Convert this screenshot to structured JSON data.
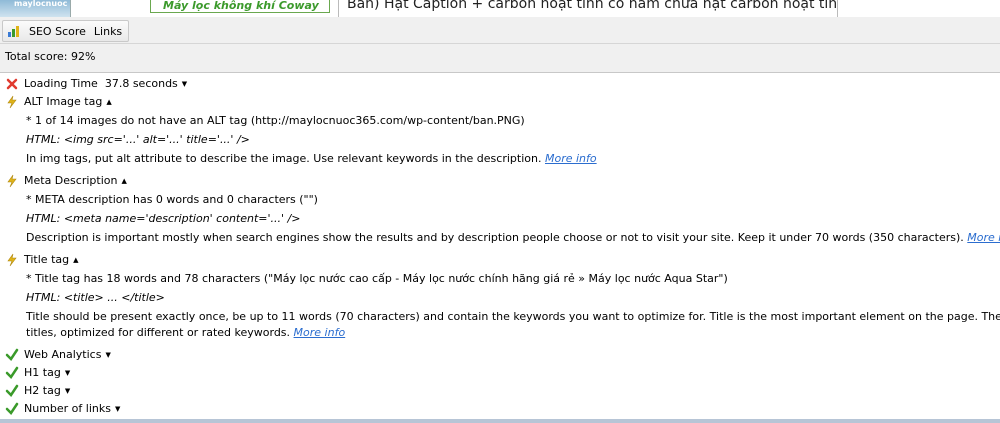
{
  "webpage": {
    "green_banner": "Máy lọc không khí Coway",
    "description_fragment": "Bản) Hạt Caption + carbon hoạt tính có hàm chứa hạt carbon hoạt tính, sẽ khử"
  },
  "toolbar": {
    "tab_seo_score": "SEO Score",
    "tab_links": "Links"
  },
  "summary": {
    "total_score": "Total score: 92%"
  },
  "items": [
    {
      "status": "error",
      "title": "Loading Time",
      "value": "37.8 seconds",
      "expanded": false,
      "details": []
    },
    {
      "status": "warning",
      "title": "ALT Image tag",
      "expanded": true,
      "details": [
        "* 1 of 14 images do not have an ALT tag (http://maylocnuoc365.com/wp-content/ban.PNG)",
        "HTML: <img src='...' alt='...' title='...' />",
        "In img tags, put alt attribute to describe the image. Use relevant keywords in the description."
      ],
      "more_info": "More info"
    },
    {
      "status": "warning",
      "title": "Meta Description",
      "expanded": true,
      "details": [
        "* META description has 0 words and 0 characters (\"\")",
        "HTML: <meta name='description' content='...' />",
        "Description is important mostly when search engines show the results and by description people choose or not to visit your site. Keep it under 70 words (350 characters)."
      ],
      "more_info": "More info"
    },
    {
      "status": "warning",
      "title": "Title tag",
      "expanded": true,
      "details": [
        "* Title tag has 18 words and 78 characters (\"Máy lọc nước cao cấp - Máy lọc nước chính hãng giá rẻ » Máy lọc nước Aqua Star\")",
        "HTML: <title> ... </title>",
        "Title should be present exactly once, be up to 11 words (70 characters) and contain the keywords you want to optimize for. Title is the most important element on the page. The other pages from your w",
        "titles, optimized for different or rated keywords."
      ],
      "more_info": "More info"
    },
    {
      "status": "ok",
      "title": "Web Analytics",
      "expanded": false,
      "details": []
    },
    {
      "status": "ok",
      "title": "H1 tag",
      "expanded": false,
      "details": []
    },
    {
      "status": "ok",
      "title": "H2 tag",
      "expanded": false,
      "details": []
    },
    {
      "status": "ok",
      "title": "Number of links",
      "expanded": false,
      "details": []
    }
  ],
  "colors": {
    "error": "#e03a2f",
    "warning": "#e0b419",
    "ok": "#3a9a2a",
    "link": "#2b6dcf"
  },
  "icons": {
    "error": "red-x-icon",
    "warning": "lightning-warning-icon",
    "ok": "green-check-icon",
    "expanded": "triangle-up-icon",
    "collapsed": "triangle-down-icon"
  }
}
